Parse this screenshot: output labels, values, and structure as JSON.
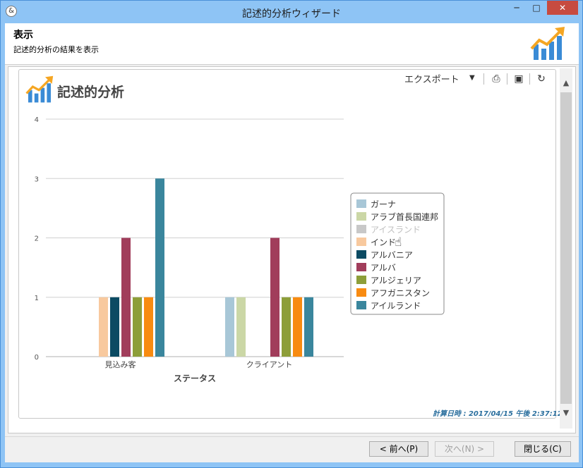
{
  "window": {
    "title": "記述的分析ウィザード",
    "app_icon": "&"
  },
  "header": {
    "title": "表示",
    "subtitle": "記述的分析の結果を表示"
  },
  "card": {
    "title": "記述的分析",
    "export_label": "エクスポート",
    "timestamp": "計算日時 : 2017/04/15 午後 2:37:12"
  },
  "buttons": {
    "prev": "< 前へ(P)",
    "next": "次へ(N) >",
    "close": "閉じる(C)"
  },
  "colors": {
    "accent": "#f5a623",
    "bar_blue": "#3a8bd6"
  },
  "chart_data": {
    "type": "bar",
    "xlabel": "ステータス",
    "ylabel": "",
    "ylim": [
      0,
      4
    ],
    "yticks": [
      0,
      1,
      2,
      3,
      4
    ],
    "grid": true,
    "legend_position": "right",
    "categories": [
      "見込み客",
      "クライアント"
    ],
    "series": [
      {
        "name": "ガーナ",
        "color": "#a8c7d7",
        "values": [
          0,
          1
        ]
      },
      {
        "name": "アラブ首長国連邦",
        "color": "#cbd7a6",
        "values": [
          0,
          1
        ]
      },
      {
        "name": "アイスランド",
        "color": "#c8c8c8",
        "values": [
          0,
          0
        ],
        "hidden": true
      },
      {
        "name": "インド",
        "color": "#f8c99e",
        "values": [
          1,
          0
        ]
      },
      {
        "name": "アルバニア",
        "color": "#0c4b63",
        "values": [
          1,
          0
        ]
      },
      {
        "name": "アルバ",
        "color": "#a13d5b",
        "values": [
          2,
          2
        ]
      },
      {
        "name": "アルジェリア",
        "color": "#8d9e39",
        "values": [
          1,
          1
        ]
      },
      {
        "name": "アフガニスタン",
        "color": "#f88b11",
        "values": [
          1,
          1
        ]
      },
      {
        "name": "アイルランド",
        "color": "#3a869d",
        "values": [
          3,
          1
        ]
      }
    ]
  }
}
